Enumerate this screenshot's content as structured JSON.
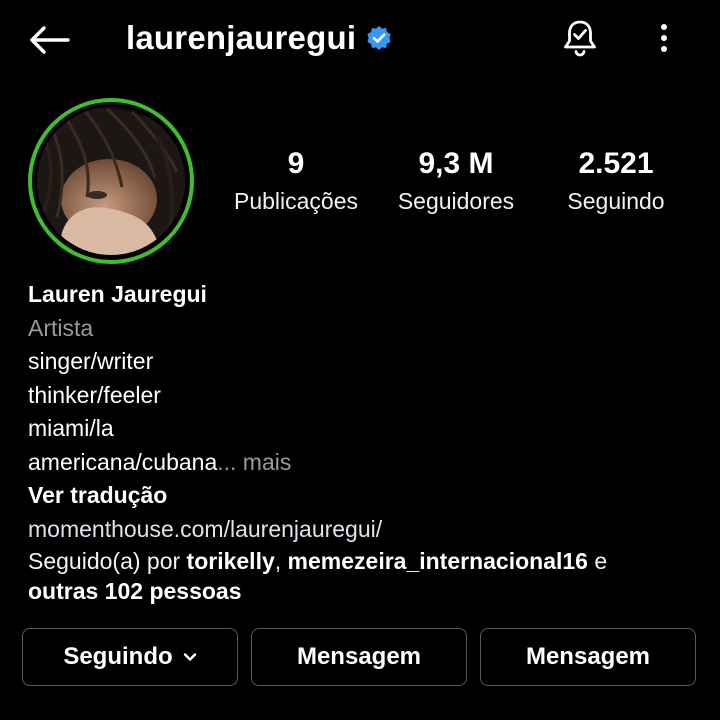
{
  "header": {
    "username": "laurenjauregui",
    "back_icon": "arrow-left-icon",
    "verified_icon": "verified-badge-icon",
    "bell_icon": "notification-bell-icon",
    "more_icon": "more-vertical-icon"
  },
  "stats": {
    "posts": {
      "value": "9",
      "label": "Publicações"
    },
    "followers": {
      "value": "9,3 M",
      "label": "Seguidores"
    },
    "following": {
      "value": "2.521",
      "label": "Seguindo"
    }
  },
  "bio": {
    "name": "Lauren Jauregui",
    "category": "Artista",
    "lines": [
      "singer/writer",
      "thinker/feeler",
      "miami/la",
      "americana/cubana"
    ],
    "ellipsis": "... mais",
    "translate": "Ver tradução",
    "link": "momenthouse.com/laurenjauregui/"
  },
  "followed_by": {
    "prefix": "Seguido(a) por ",
    "user1": "torikelly",
    "sep": ", ",
    "user2": "memezeira_internacional16",
    "and": " e",
    "others": "outras 102 pessoas"
  },
  "buttons": {
    "following": "Seguindo",
    "message1": "Mensagem",
    "message2": "Mensagem"
  },
  "colors": {
    "background": "#000000",
    "story_ring": "#3fbf2e",
    "verified": "#3897f0",
    "muted_text": "#9a9a9a"
  }
}
